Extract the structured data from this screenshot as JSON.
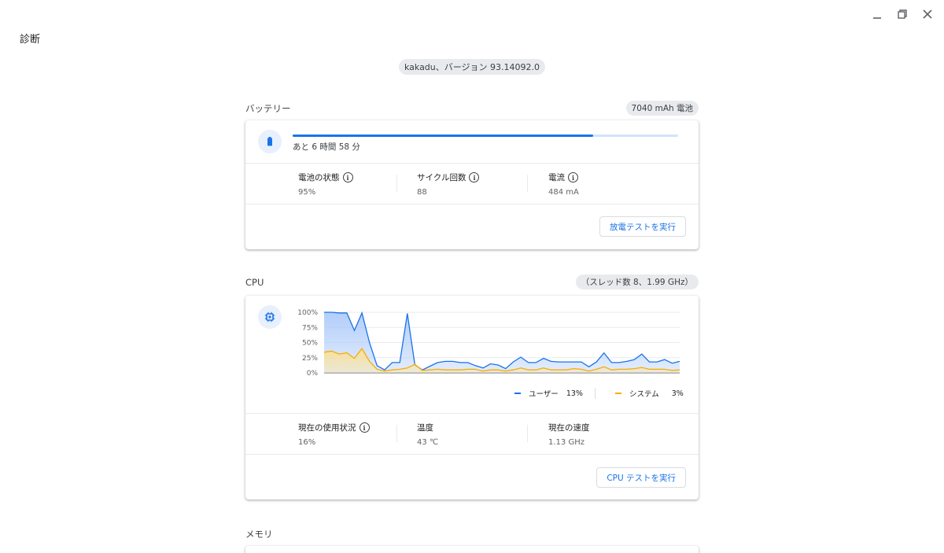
{
  "window": {
    "title": "診断",
    "controls": [
      "minimize-icon",
      "restore-icon",
      "close-icon"
    ]
  },
  "version": "kakadu、バージョン 93.14092.0",
  "battery": {
    "section_title": "バッテリー",
    "capacity": "7040 mAh 電池",
    "icon": "battery-icon",
    "charge_fraction": 0.78,
    "remaining_text": "あと 6 時間 58 分",
    "metrics": [
      {
        "label": "電池の状態",
        "value": "95%"
      },
      {
        "label": "サイクル回数",
        "value": "88"
      },
      {
        "label": "電流",
        "value": "484 mA"
      }
    ],
    "action_label": "放電テストを実行"
  },
  "cpu": {
    "section_title": "CPU",
    "spec": "（スレッド数 8、1.99 GHz）",
    "icon": "cpu-chip-icon",
    "metrics": [
      {
        "label": "現在の使用状況",
        "value": "16%"
      },
      {
        "label": "温度",
        "value": "43 ℃"
      },
      {
        "label": "現在の速度",
        "value": "1.13 GHz"
      }
    ],
    "action_label": "CPU テストを実行"
  },
  "memory": {
    "section_title": "メモリ"
  },
  "colors": {
    "accent": "#1a73e8",
    "system": "#f9ab00",
    "pill_bg": "#e8eaed"
  },
  "chart_data": {
    "type": "area",
    "ylim": [
      0,
      100
    ],
    "y_ticks": [
      "100%",
      "75%",
      "50%",
      "25%",
      "0%"
    ],
    "grid": true,
    "legend_position": "bottom-right",
    "series": [
      {
        "name": "ユーザー",
        "current": "13%",
        "color": "#1a73e8",
        "values": [
          100,
          100,
          99,
          99,
          70,
          99,
          50,
          12,
          5,
          17,
          17,
          98,
          13,
          5,
          11,
          17,
          19,
          19,
          17,
          17,
          12,
          8,
          15,
          13,
          7,
          18,
          26,
          17,
          17,
          24,
          19,
          18,
          18,
          18,
          18,
          10,
          18,
          33,
          17,
          17,
          19,
          22,
          31,
          18,
          18,
          22,
          16,
          19
        ]
      },
      {
        "name": "システム",
        "current": "3%",
        "color": "#f9ab00",
        "values": [
          34,
          36,
          31,
          33,
          24,
          40,
          19,
          6,
          3,
          5,
          6,
          8,
          14,
          4,
          5,
          6,
          5,
          5,
          5,
          6,
          6,
          3,
          5,
          5,
          3,
          5,
          8,
          5,
          5,
          8,
          5,
          5,
          5,
          7,
          6,
          3,
          6,
          10,
          5,
          6,
          6,
          7,
          9,
          6,
          6,
          6,
          4,
          5
        ]
      }
    ]
  }
}
